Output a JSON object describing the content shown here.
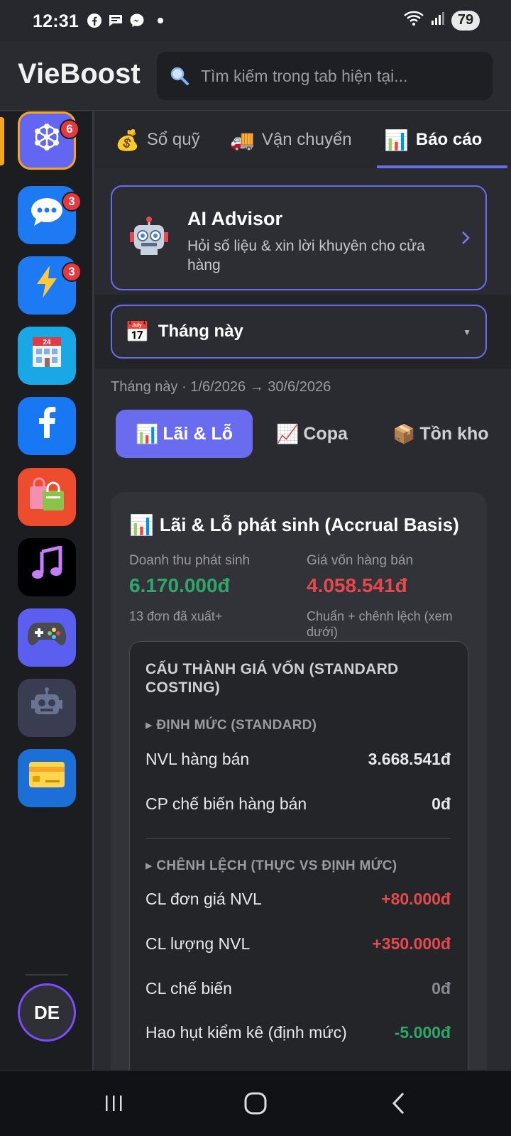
{
  "status": {
    "time": "12:31",
    "battery": "79"
  },
  "app": {
    "logo": "VieBoost"
  },
  "search": {
    "placeholder": "Tìm kiếm trong tab hiện tại..."
  },
  "rail": {
    "apps": [
      {
        "name": "hub-app",
        "icon": "network-icon",
        "badge": "6",
        "bg": "#6366f1"
      },
      {
        "name": "chat-app",
        "icon": "chat-bubble-icon",
        "badge": "3",
        "bg": "#1d7af3"
      },
      {
        "name": "boost-app",
        "icon": "lightning-icon",
        "badge": "3",
        "bg": "#1d7af3"
      },
      {
        "name": "store-app",
        "icon": "store-24-icon",
        "badge": "",
        "bg": "#1aa7e6"
      },
      {
        "name": "facebook-app",
        "icon": "facebook-icon",
        "badge": "",
        "bg": "#1877f2"
      },
      {
        "name": "shop-app",
        "icon": "shopping-bags-icon",
        "badge": "",
        "bg": "#ee4d2d"
      },
      {
        "name": "music-app",
        "icon": "music-note-icon",
        "badge": "",
        "bg": "#000000"
      },
      {
        "name": "game-app",
        "icon": "gamepad-icon",
        "badge": "",
        "bg": "#5b5ff0"
      },
      {
        "name": "robot-app",
        "icon": "robot-icon",
        "badge": "",
        "bg": "#3a3c52"
      },
      {
        "name": "card-app",
        "icon": "credit-card-icon",
        "badge": "",
        "bg": "#1d6fd8"
      }
    ],
    "avatar": "DE"
  },
  "tabs": [
    {
      "emoji": "💰",
      "label": "Sổ quỹ"
    },
    {
      "emoji": "🚚",
      "label": "Vận chuyển"
    },
    {
      "emoji": "📊",
      "label": "Báo cáo"
    }
  ],
  "ai": {
    "title": "AI Advisor",
    "desc": "Hỏi số liệu & xin lời khuyên cho cửa hàng"
  },
  "period": {
    "emoji": "📅",
    "label": "Tháng này"
  },
  "range": "Tháng này · 1/6/2026 → 30/6/2026",
  "subtabs": [
    {
      "emoji": "📊",
      "label": "Lãi & Lỗ"
    },
    {
      "emoji": "📈",
      "label": "Copa"
    },
    {
      "emoji": "📦",
      "label": "Tồn kho"
    }
  ],
  "pl": {
    "emoji": "📊",
    "title": "Lãi & Lỗ phát sinh (Accrual Basis)",
    "revenue_label": "Doanh thu phát sinh",
    "revenue_value": "6.170.000đ",
    "revenue_sub": "13 đơn đã xuất+",
    "cogs_label": "Giá vốn hàng bán",
    "cogs_value": "4.058.541đ",
    "cogs_sub": "Chuẩn + chênh lệch (xem dưới)"
  },
  "cost": {
    "heading": "CẤU THÀNH GIÁ VỐN (STANDARD COSTING)",
    "standard_heading": "▸ ĐỊNH MỨC (STANDARD)",
    "standard_rows": [
      {
        "label": "NVL hàng bán",
        "value": "3.668.541đ"
      },
      {
        "label": "CP chế biến hàng bán",
        "value": "0đ"
      }
    ],
    "variance_heading": "▸ CHÊNH LỆCH (THỰC VS ĐỊNH MỨC)",
    "variance_rows": [
      {
        "label": "CL đơn giá NVL",
        "value": "+80.000đ"
      },
      {
        "label": "CL lượng NVL",
        "value": "+350.000đ"
      },
      {
        "label": "CL chế biến",
        "value": "0đ"
      },
      {
        "label": "Hao hụt kiểm kê (định mức)",
        "value": "-5.000đ"
      }
    ]
  },
  "colors": {
    "accent": "#6a6cf0",
    "warning": "#f5a524",
    "positive": "#2ea86a",
    "negative": "#e5484d"
  }
}
